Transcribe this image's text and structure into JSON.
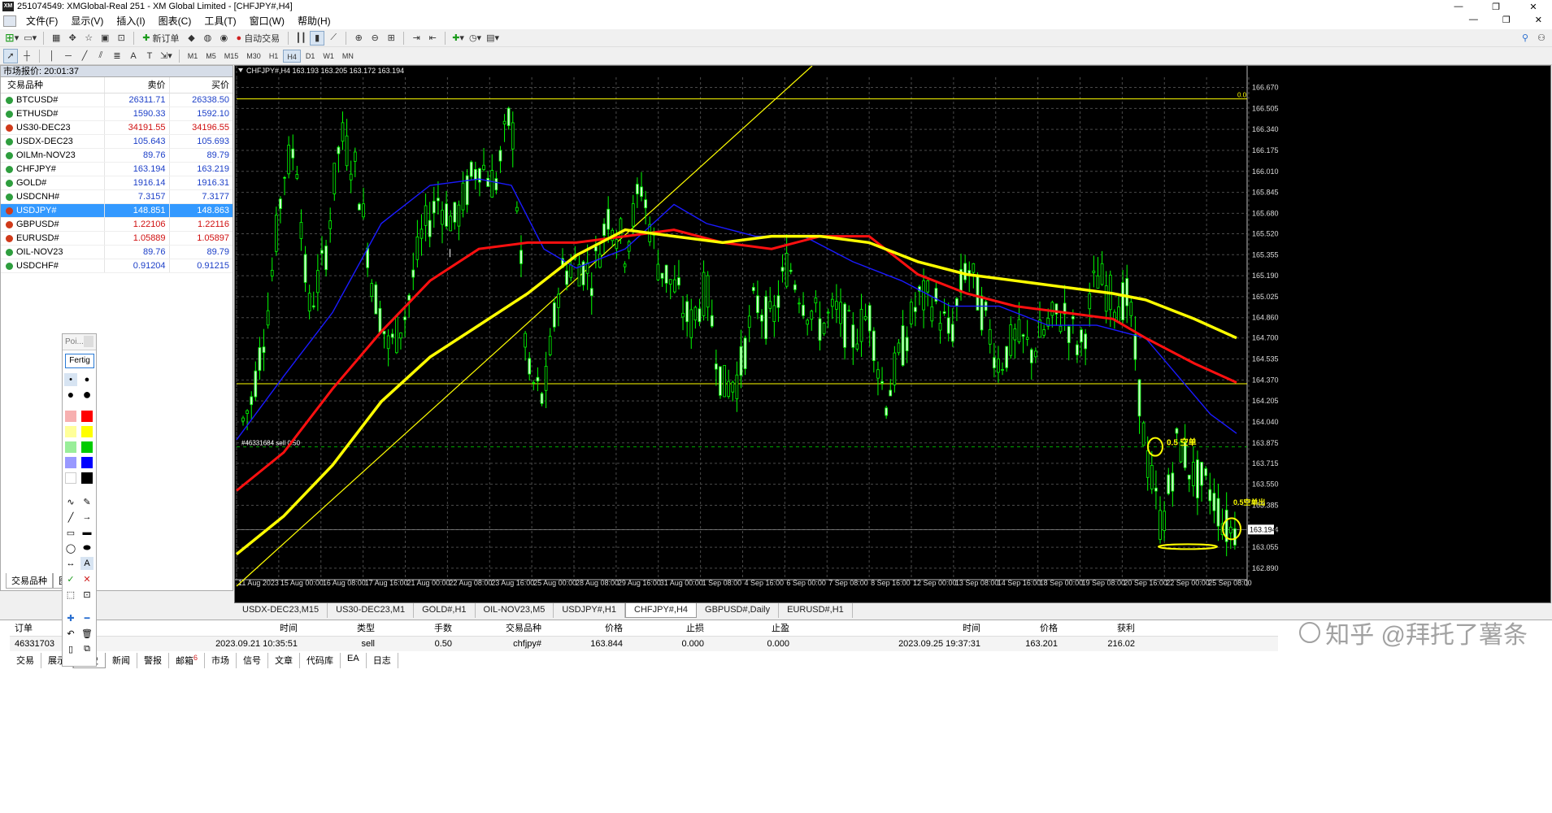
{
  "title": {
    "text": "251074549: XMGlobal-Real 251 - XM Global Limited - [CHFJPY#,H4]",
    "logo": "XM"
  },
  "window_controls": [
    "—",
    "❐",
    "✕"
  ],
  "menu": [
    "文件(F)",
    "显示(V)",
    "插入(I)",
    "图表(C)",
    "工具(T)",
    "窗口(W)",
    "帮助(H)"
  ],
  "mdi_controls": [
    "—",
    "❐",
    "✕"
  ],
  "toolbar": {
    "new_order": "新订单",
    "auto_trading": "自动交易"
  },
  "timeframes": [
    "M1",
    "M5",
    "M15",
    "M30",
    "H1",
    "H4",
    "D1",
    "W1",
    "MN"
  ],
  "active_timeframe": "H4",
  "market_watch": {
    "title": "市场报价: 20:01:37",
    "headers": {
      "symbol": "交易品种",
      "bid": "卖价",
      "ask": "买价"
    },
    "rows": [
      {
        "symbol": "BTCUSD#",
        "bid": "26311.71",
        "ask": "26338.50",
        "color": "blue",
        "dot": "#2e9e3e"
      },
      {
        "symbol": "ETHUSD#",
        "bid": "1590.33",
        "ask": "1592.10",
        "color": "blue",
        "dot": "#2e9e3e"
      },
      {
        "symbol": "US30-DEC23",
        "bid": "34191.55",
        "ask": "34196.55",
        "color": "red",
        "dot": "#d03a1a"
      },
      {
        "symbol": "USDX-DEC23",
        "bid": "105.643",
        "ask": "105.693",
        "color": "blue",
        "dot": "#2e9e3e"
      },
      {
        "symbol": "OILMn-NOV23",
        "bid": "89.76",
        "ask": "89.79",
        "color": "blue",
        "dot": "#2e9e3e"
      },
      {
        "symbol": "CHFJPY#",
        "bid": "163.194",
        "ask": "163.219",
        "color": "blue",
        "dot": "#2e9e3e"
      },
      {
        "symbol": "GOLD#",
        "bid": "1916.14",
        "ask": "1916.31",
        "color": "blue",
        "dot": "#2e9e3e"
      },
      {
        "symbol": "USDCNH#",
        "bid": "7.3157",
        "ask": "7.3177",
        "color": "blue",
        "dot": "#2e9e3e"
      },
      {
        "symbol": "USDJPY#",
        "bid": "148.851",
        "ask": "148.863",
        "color": "blue",
        "dot": "#d03a1a",
        "selected": true
      },
      {
        "symbol": "GBPUSD#",
        "bid": "1.22106",
        "ask": "1.22116",
        "color": "red",
        "dot": "#d03a1a"
      },
      {
        "symbol": "EURUSD#",
        "bid": "1.05889",
        "ask": "1.05897",
        "color": "red",
        "dot": "#d03a1a"
      },
      {
        "symbol": "OIL-NOV23",
        "bid": "89.76",
        "ask": "89.79",
        "color": "blue",
        "dot": "#2e9e3e"
      },
      {
        "symbol": "USDCHF#",
        "bid": "0.91204",
        "ask": "0.91215",
        "color": "blue",
        "dot": "#2e9e3e"
      }
    ],
    "tabs": [
      "交易品种",
      "图"
    ]
  },
  "chart": {
    "header": "CHFJPY#,H4  163.193 163.205 163.172 163.194",
    "top_level_label": "0.0",
    "price_labels": [
      "166.670",
      "166.505",
      "166.340",
      "166.175",
      "166.010",
      "165.845",
      "165.680",
      "165.520",
      "165.355",
      "165.190",
      "165.025",
      "164.860",
      "164.700",
      "164.535",
      "164.370",
      "164.205",
      "164.040",
      "163.875",
      "163.715",
      "163.550",
      "163.385",
      "163.194",
      "163.055",
      "162.890"
    ],
    "current_price": "163.194",
    "dates": [
      "11 Aug 2023",
      "15 Aug 00:00",
      "16 Aug 08:00",
      "17 Aug 16:00",
      "21 Aug 00:00",
      "22 Aug 08:00",
      "23 Aug 16:00",
      "25 Aug 00:00",
      "28 Aug 08:00",
      "29 Aug 16:00",
      "31 Aug 00:00",
      "1 Sep 08:00",
      "4 Sep 16:00",
      "6 Sep 00:00",
      "7 Sep 08:00",
      "8 Sep 16:00",
      "12 Sep 00:00",
      "13 Sep 08:00",
      "14 Sep 16:00",
      "18 Sep 00:00",
      "19 Sep 08:00",
      "20 Sep 16:00",
      "22 Sep 00:00",
      "25 Sep 08:00"
    ],
    "order_label": "#46331684 sell 0.50",
    "annotation1": "0.5 空单",
    "annotation2": "0.5空单出",
    "colors": {
      "candle": "#00ff00",
      "ma_blue": "#1a1aff",
      "ma_red": "#ff1010",
      "ma_yellow": "#ffff00",
      "grid": "#4a4a4a"
    }
  },
  "chart_tabs": [
    "USDX-DEC23,M15",
    "US30-DEC23,M1",
    "GOLD#,H1",
    "OIL-NOV23,M5",
    "USDJPY#,H1",
    "CHFJPY#,H4",
    "GBPUSD#,Daily",
    "EURUSD#,H1"
  ],
  "active_chart_tab": "CHFJPY#,H4",
  "terminal": {
    "headers": [
      "订单",
      "时间",
      "类型",
      "手数",
      "交易品种",
      "价格",
      "止损",
      "止盈",
      "时间",
      "价格",
      "获利"
    ],
    "row": [
      "46331703",
      "2023.09.21 10:35:51",
      "sell",
      "0.50",
      "chfjpy#",
      "163.844",
      "0.000",
      "0.000",
      "2023.09.25 19:37:31",
      "163.201",
      "216.02"
    ],
    "tabs": [
      "交易",
      "展示",
      "历史",
      "新闻",
      "警报",
      "邮箱",
      "市场",
      "信号",
      "文章",
      "代码库",
      "EA",
      "日志"
    ],
    "mail_badge": "6"
  },
  "palette": {
    "title": "Poi...",
    "done": "Fertig"
  },
  "watermark": "知乎 @拜托了薯条"
}
